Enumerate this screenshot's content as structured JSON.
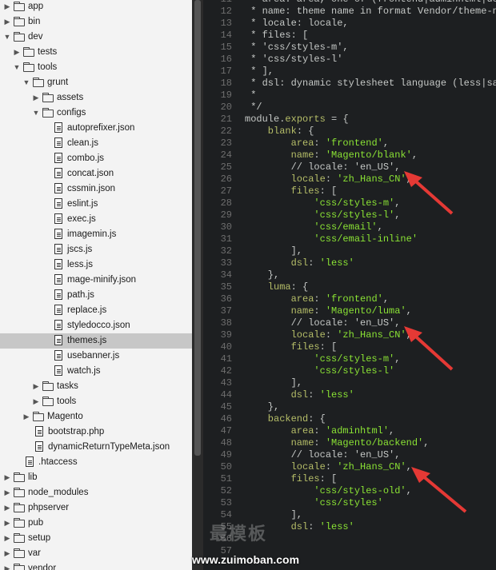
{
  "tree": {
    "rows": [
      {
        "label": "app",
        "type": "folder",
        "state": "closed",
        "depth": 0
      },
      {
        "label": "bin",
        "type": "folder",
        "state": "closed",
        "depth": 0
      },
      {
        "label": "dev",
        "type": "folder",
        "state": "open",
        "depth": 0
      },
      {
        "label": "tests",
        "type": "folder",
        "state": "closed",
        "depth": 1
      },
      {
        "label": "tools",
        "type": "folder",
        "state": "open",
        "depth": 1
      },
      {
        "label": "grunt",
        "type": "folder",
        "state": "open",
        "depth": 2
      },
      {
        "label": "assets",
        "type": "folder",
        "state": "closed",
        "depth": 3
      },
      {
        "label": "configs",
        "type": "folder",
        "state": "open",
        "depth": 3
      },
      {
        "label": "autoprefixer.json",
        "type": "file",
        "depth": 4
      },
      {
        "label": "clean.js",
        "type": "file",
        "depth": 4
      },
      {
        "label": "combo.js",
        "type": "file",
        "depth": 4
      },
      {
        "label": "concat.json",
        "type": "file",
        "depth": 4
      },
      {
        "label": "cssmin.json",
        "type": "file",
        "depth": 4
      },
      {
        "label": "eslint.js",
        "type": "file",
        "depth": 4
      },
      {
        "label": "exec.js",
        "type": "file",
        "depth": 4
      },
      {
        "label": "imagemin.js",
        "type": "file",
        "depth": 4
      },
      {
        "label": "jscs.js",
        "type": "file",
        "depth": 4
      },
      {
        "label": "less.js",
        "type": "file",
        "depth": 4
      },
      {
        "label": "mage-minify.json",
        "type": "file",
        "depth": 4
      },
      {
        "label": "path.js",
        "type": "file",
        "depth": 4
      },
      {
        "label": "replace.js",
        "type": "file",
        "depth": 4
      },
      {
        "label": "styledocco.json",
        "type": "file",
        "depth": 4
      },
      {
        "label": "themes.js",
        "type": "file",
        "depth": 4,
        "selected": true
      },
      {
        "label": "usebanner.js",
        "type": "file",
        "depth": 4
      },
      {
        "label": "watch.js",
        "type": "file",
        "depth": 4
      },
      {
        "label": "tasks",
        "type": "folder",
        "state": "closed",
        "depth": 3
      },
      {
        "label": "tools",
        "type": "folder",
        "state": "closed",
        "depth": 3
      },
      {
        "label": "Magento",
        "type": "folder",
        "state": "closed",
        "depth": 2
      },
      {
        "label": "bootstrap.php",
        "type": "file",
        "depth": 2
      },
      {
        "label": "dynamicReturnTypeMeta.json",
        "type": "file",
        "depth": 2
      },
      {
        "label": ".htaccess",
        "type": "file",
        "depth": 1
      },
      {
        "label": "lib",
        "type": "folder",
        "state": "closed",
        "depth": 0
      },
      {
        "label": "node_modules",
        "type": "folder",
        "state": "closed",
        "depth": 0
      },
      {
        "label": "phpserver",
        "type": "folder",
        "state": "closed",
        "depth": 0
      },
      {
        "label": "pub",
        "type": "folder",
        "state": "closed",
        "depth": 0
      },
      {
        "label": "setup",
        "type": "folder",
        "state": "closed",
        "depth": 0
      },
      {
        "label": "var",
        "type": "folder",
        "state": "closed",
        "depth": 0
      },
      {
        "label": "vendor",
        "type": "folder",
        "state": "closed",
        "depth": 0
      }
    ]
  },
  "editor": {
    "lines": [
      {
        "n": "11",
        "parts": [
          [
            "c-com",
            " * area: area, one of (frontend|adminhtml|doc"
          ]
        ]
      },
      {
        "n": "12",
        "parts": [
          [
            "c-com",
            " * name: theme name in format Vendor/theme-na"
          ]
        ]
      },
      {
        "n": "13",
        "parts": [
          [
            "c-com",
            " * locale: locale,"
          ]
        ]
      },
      {
        "n": "14",
        "parts": [
          [
            "c-com",
            " * files: ["
          ]
        ]
      },
      {
        "n": "15",
        "parts": [
          [
            "c-com",
            " * 'css/styles-m',"
          ]
        ]
      },
      {
        "n": "16",
        "parts": [
          [
            "c-com",
            " * 'css/styles-l'"
          ]
        ]
      },
      {
        "n": "17",
        "parts": [
          [
            "c-com",
            " * ],"
          ]
        ]
      },
      {
        "n": "18",
        "parts": [
          [
            "c-com",
            " * dsl: dynamic stylesheet language (less|sas"
          ]
        ]
      },
      {
        "n": "19",
        "parts": [
          [
            "c-com",
            " *"
          ]
        ]
      },
      {
        "n": "20",
        "parts": [
          [
            "c-com",
            " */"
          ]
        ]
      },
      {
        "n": "21",
        "parts": [
          [
            "c-obj",
            "module"
          ],
          [
            "c-pun",
            "."
          ],
          [
            "c-key",
            "exports"
          ],
          [
            "c-pun",
            " = {"
          ]
        ]
      },
      {
        "n": "22",
        "parts": [
          [
            "c-key",
            "    blank"
          ],
          [
            "c-pun",
            ": {"
          ]
        ]
      },
      {
        "n": "23",
        "parts": [
          [
            "c-key",
            "        area"
          ],
          [
            "c-pun",
            ": "
          ],
          [
            "c-str",
            "'frontend'"
          ],
          [
            "c-pun",
            ","
          ]
        ]
      },
      {
        "n": "24",
        "parts": [
          [
            "c-key",
            "        name"
          ],
          [
            "c-pun",
            ": "
          ],
          [
            "c-str",
            "'Magento/blank'"
          ],
          [
            "c-pun",
            ","
          ]
        ]
      },
      {
        "n": "25",
        "parts": [
          [
            "c-com",
            "        // locale: 'en_US',"
          ]
        ]
      },
      {
        "n": "26",
        "parts": [
          [
            "c-key",
            "        locale"
          ],
          [
            "c-pun",
            ": "
          ],
          [
            "c-str",
            "'zh_Hans_CN'"
          ],
          [
            "c-pun",
            ","
          ]
        ]
      },
      {
        "n": "27",
        "parts": [
          [
            "c-key",
            "        files"
          ],
          [
            "c-pun",
            ": ["
          ]
        ]
      },
      {
        "n": "28",
        "parts": [
          [
            "c-str",
            "            'css/styles-m'"
          ],
          [
            "c-pun",
            ","
          ]
        ]
      },
      {
        "n": "29",
        "parts": [
          [
            "c-str",
            "            'css/styles-l'"
          ],
          [
            "c-pun",
            ","
          ]
        ]
      },
      {
        "n": "30",
        "parts": [
          [
            "c-str",
            "            'css/email'"
          ],
          [
            "c-pun",
            ","
          ]
        ]
      },
      {
        "n": "31",
        "parts": [
          [
            "c-str",
            "            'css/email-inline'"
          ]
        ]
      },
      {
        "n": "32",
        "parts": [
          [
            "c-pun",
            "        ],"
          ]
        ]
      },
      {
        "n": "33",
        "parts": [
          [
            "c-key",
            "        dsl"
          ],
          [
            "c-pun",
            ": "
          ],
          [
            "c-str",
            "'less'"
          ]
        ]
      },
      {
        "n": "34",
        "parts": [
          [
            "c-pun",
            "    },"
          ]
        ]
      },
      {
        "n": "35",
        "parts": [
          [
            "c-key",
            "    luma"
          ],
          [
            "c-pun",
            ": {"
          ]
        ]
      },
      {
        "n": "36",
        "parts": [
          [
            "c-key",
            "        area"
          ],
          [
            "c-pun",
            ": "
          ],
          [
            "c-str",
            "'frontend'"
          ],
          [
            "c-pun",
            ","
          ]
        ]
      },
      {
        "n": "37",
        "parts": [
          [
            "c-key",
            "        name"
          ],
          [
            "c-pun",
            ": "
          ],
          [
            "c-str",
            "'Magento/luma'"
          ],
          [
            "c-pun",
            ","
          ]
        ]
      },
      {
        "n": "38",
        "parts": [
          [
            "c-com",
            "        // locale: 'en_US',"
          ]
        ]
      },
      {
        "n": "39",
        "parts": [
          [
            "c-key",
            "        locale"
          ],
          [
            "c-pun",
            ": "
          ],
          [
            "c-str",
            "'zh_Hans_CN'"
          ],
          [
            "c-pun",
            ","
          ]
        ]
      },
      {
        "n": "40",
        "parts": [
          [
            "c-key",
            "        files"
          ],
          [
            "c-pun",
            ": ["
          ]
        ]
      },
      {
        "n": "41",
        "parts": [
          [
            "c-str",
            "            'css/styles-m'"
          ],
          [
            "c-pun",
            ","
          ]
        ]
      },
      {
        "n": "42",
        "parts": [
          [
            "c-str",
            "            'css/styles-l'"
          ]
        ]
      },
      {
        "n": "43",
        "parts": [
          [
            "c-pun",
            "        ],"
          ]
        ]
      },
      {
        "n": "44",
        "parts": [
          [
            "c-key",
            "        dsl"
          ],
          [
            "c-pun",
            ": "
          ],
          [
            "c-str",
            "'less'"
          ]
        ]
      },
      {
        "n": "45",
        "parts": [
          [
            "c-pun",
            "    },"
          ]
        ]
      },
      {
        "n": "46",
        "parts": [
          [
            "c-key",
            "    backend"
          ],
          [
            "c-pun",
            ": {"
          ]
        ]
      },
      {
        "n": "47",
        "parts": [
          [
            "c-key",
            "        area"
          ],
          [
            "c-pun",
            ": "
          ],
          [
            "c-str",
            "'adminhtml'"
          ],
          [
            "c-pun",
            ","
          ]
        ]
      },
      {
        "n": "48",
        "parts": [
          [
            "c-key",
            "        name"
          ],
          [
            "c-pun",
            ": "
          ],
          [
            "c-str",
            "'Magento/backend'"
          ],
          [
            "c-pun",
            ","
          ]
        ]
      },
      {
        "n": "49",
        "parts": [
          [
            "c-com",
            "        // locale: 'en_US',"
          ]
        ]
      },
      {
        "n": "50",
        "parts": [
          [
            "c-key",
            "        locale"
          ],
          [
            "c-pun",
            ": "
          ],
          [
            "c-str",
            "'zh_Hans_CN'"
          ],
          [
            "c-pun",
            ","
          ]
        ]
      },
      {
        "n": "51",
        "parts": [
          [
            "c-key",
            "        files"
          ],
          [
            "c-pun",
            ": ["
          ]
        ]
      },
      {
        "n": "52",
        "parts": [
          [
            "c-str",
            "            'css/styles-old'"
          ],
          [
            "c-pun",
            ","
          ]
        ]
      },
      {
        "n": "53",
        "parts": [
          [
            "c-str",
            "            'css/styles'"
          ]
        ]
      },
      {
        "n": "54",
        "parts": [
          [
            "c-pun",
            "        ],"
          ]
        ]
      },
      {
        "n": "55",
        "parts": [
          [
            "c-key",
            "        dsl"
          ],
          [
            "c-pun",
            ": "
          ],
          [
            "c-str",
            "'less'"
          ]
        ]
      },
      {
        "n": "56",
        "parts": [
          [
            "c-pun",
            ""
          ]
        ]
      },
      {
        "n": "57",
        "parts": [
          [
            "c-pun",
            ""
          ]
        ]
      }
    ]
  },
  "annotations": {
    "arrow_color": "#e53935",
    "arrows": [
      "arrow-line-25",
      "arrow-line-38",
      "arrow-line-49"
    ]
  },
  "watermark": {
    "text": "www.zuimoban.com",
    "logo_text": "最模板"
  },
  "colors": {
    "sidebar_bg": "#f3f3f3",
    "editor_bg": "#1d1f21",
    "selected_row": "#c7c7c7",
    "string": "#8ae234",
    "key": "#b5bd68"
  }
}
